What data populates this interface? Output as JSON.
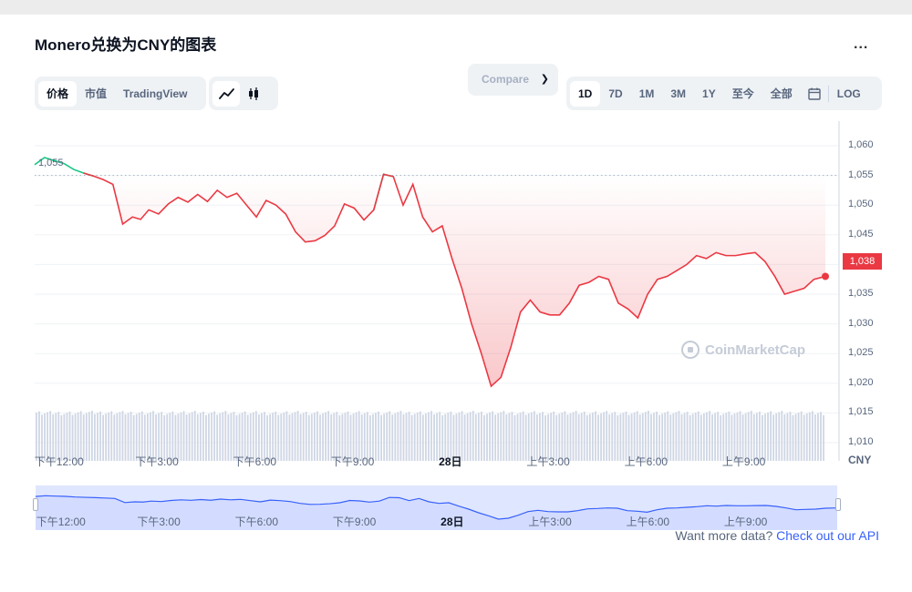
{
  "header": {
    "title": "Monero兑换为CNY的图表",
    "more_label": "..."
  },
  "toolbar": {
    "view_tabs": [
      "价格",
      "市值",
      "TradingView"
    ],
    "active_view": "价格",
    "chart_type_icons": [
      "line-chart-icon",
      "candlestick-icon"
    ],
    "compare_label": "Compare",
    "ranges": [
      "1D",
      "7D",
      "1M",
      "3M",
      "1Y",
      "至今",
      "全部"
    ],
    "active_range": "1D",
    "log_label": "LOG"
  },
  "colors": {
    "up": "#16c784",
    "down": "#ea3943",
    "volume": "#cfd6e4",
    "navigator": "#dfe6ff"
  },
  "watermark": "CoinMarketCap",
  "reference_label": "1,055",
  "last_price_label": "1,038",
  "currency_label": "CNY",
  "footer": {
    "text": "Want more data?",
    "link": "Check out our API"
  },
  "chart_data": {
    "type": "line",
    "yaxis_ticks": [
      "1,060",
      "1,055",
      "1,050",
      "1,045",
      "1,040",
      "1,035",
      "1,030",
      "1,025",
      "1,020",
      "1,015",
      "1,010"
    ],
    "ylim": [
      1008,
      1063
    ],
    "reference_value": 1055,
    "last_value": 1038,
    "xaxis_ticks": [
      "下午12:00",
      "下午3:00",
      "下午6:00",
      "下午9:00",
      "28日",
      "上午3:00",
      "上午6:00",
      "上午9:00"
    ],
    "x_hours_tick": [
      1,
      4,
      7,
      10,
      13,
      16,
      19,
      22
    ],
    "x_hours_range": [
      0.25,
      24.5
    ],
    "series": [
      {
        "x_hours": [
          0.25,
          0.55,
          0.85,
          1.15,
          1.45,
          1.75,
          2.05,
          2.35,
          2.65,
          2.95,
          3.25,
          3.5,
          3.75,
          4.05,
          4.35,
          4.65,
          4.95,
          5.25,
          5.55,
          5.85,
          6.15,
          6.45,
          6.75,
          7.05,
          7.35,
          7.65,
          7.95,
          8.25,
          8.55,
          8.85,
          9.15,
          9.45,
          9.75,
          10.05,
          10.35,
          10.65,
          10.95,
          11.25,
          11.55,
          11.85,
          12.15,
          12.45,
          12.75,
          13.05,
          13.35,
          13.65,
          13.95,
          14.25,
          14.55,
          14.85,
          15.15,
          15.45,
          15.75,
          16.05,
          16.35,
          16.65,
          16.95,
          17.25,
          17.55,
          17.85,
          18.15,
          18.45,
          18.75,
          19.05,
          19.35,
          19.65,
          19.95,
          20.25,
          20.55,
          20.85,
          21.15,
          21.45,
          21.75,
          22.05,
          22.35,
          22.65,
          22.95,
          23.25,
          23.55,
          23.85,
          24.15,
          24.5
        ],
        "values": [
          1056.8,
          1058,
          1057.5,
          1057,
          1056,
          1055.4,
          1054.9,
          1054.3,
          1053.5,
          1046.8,
          1048,
          1047.6,
          1049.2,
          1048.5,
          1050.2,
          1051.3,
          1050.5,
          1051.8,
          1050.6,
          1052.5,
          1051.3,
          1052,
          1050,
          1048,
          1050.8,
          1050,
          1048.5,
          1045.5,
          1043.8,
          1044,
          1044.9,
          1046.5,
          1050.2,
          1049.5,
          1047.5,
          1049.2,
          1055.2,
          1054.8,
          1050,
          1053.5,
          1048,
          1045.5,
          1046.5,
          1041,
          1036,
          1030,
          1025,
          1019.5,
          1021,
          1026,
          1032,
          1034,
          1032,
          1031.5,
          1031.5,
          1033.5,
          1036.5,
          1037,
          1038,
          1037.5,
          1033.5,
          1032.5,
          1031,
          1035,
          1037.5,
          1038,
          1039,
          1040,
          1041.5,
          1041,
          1042,
          1041.5,
          1041.5,
          1041.8,
          1042,
          1040.5,
          1038,
          1035,
          1035.5,
          1036,
          1037.5,
          1038
        ]
      }
    ],
    "volume_note": "volume bars shown below price line"
  }
}
